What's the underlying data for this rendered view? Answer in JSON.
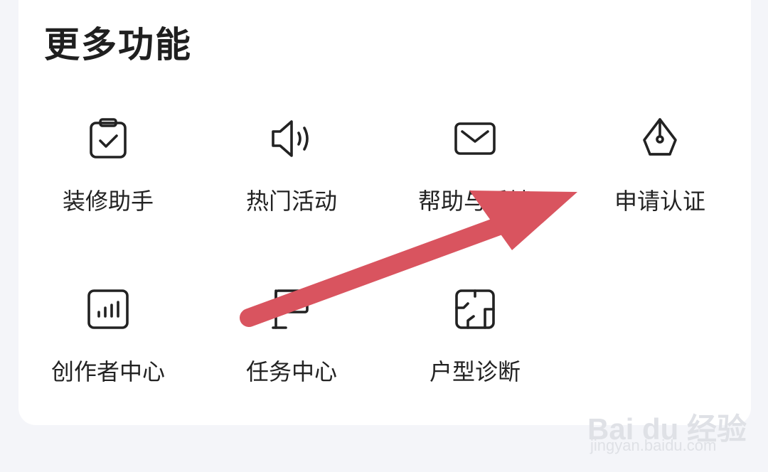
{
  "section": {
    "title": "更多功能"
  },
  "features": [
    {
      "label": "装修助手",
      "icon": "clipboard-check-icon"
    },
    {
      "label": "热门活动",
      "icon": "speaker-icon"
    },
    {
      "label": "帮助与反馈",
      "icon": "mail-icon"
    },
    {
      "label": "申请认证",
      "icon": "pen-nib-icon"
    },
    {
      "label": "创作者中心",
      "icon": "bar-chart-icon"
    },
    {
      "label": "任务中心",
      "icon": "flag-icon"
    },
    {
      "label": "户型诊断",
      "icon": "floorplan-icon"
    }
  ],
  "annotation": {
    "arrow_color": "#d9545f",
    "target": "申请认证"
  },
  "watermark": {
    "brand": "Bai du 经验",
    "url": "jingyan.baidu.com"
  },
  "colors": {
    "background": "#f4f5f9",
    "card": "#ffffff",
    "text": "#222222"
  }
}
